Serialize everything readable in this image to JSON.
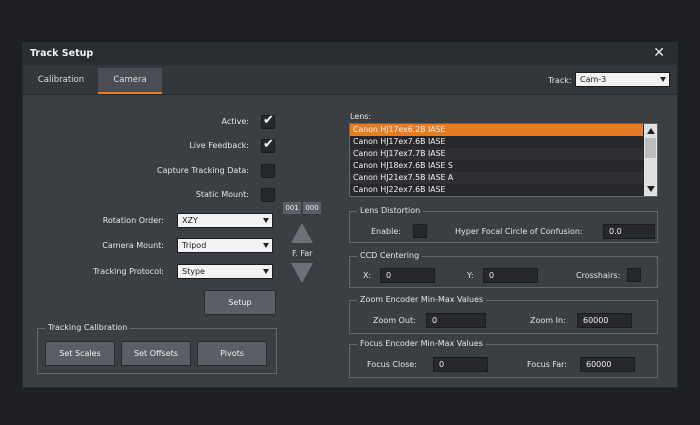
{
  "window": {
    "title": "Track Setup",
    "close_icon": "close-icon"
  },
  "tabs": [
    {
      "label": "Calibration"
    },
    {
      "label": "Camera"
    }
  ],
  "track": {
    "label": "Track:",
    "value": "Cam-3"
  },
  "camera": {
    "active_label": "Active:",
    "live_feedback_label": "Live Feedback:",
    "capture_tracking_label": "Capture Tracking Data:",
    "static_mount_label": "Static Mount:",
    "rotation_order_label": "Rotation Order:",
    "rotation_order_value": "XZY",
    "camera_mount_label": "Camera Mount:",
    "camera_mount_value": "Tripod",
    "tracking_protocol_label": "Tracking Protocol:",
    "tracking_protocol_value": "Stype",
    "setup_label": "Setup"
  },
  "checkboxes": {
    "active": true,
    "live_feedback": true,
    "capture_tracking": false,
    "static_mount": false
  },
  "tracking_calibration": {
    "title": "Tracking Calibration",
    "set_scales": "Set Scales",
    "set_offsets": "Set Offsets",
    "pivots": "Pivots"
  },
  "counter": {
    "left": "001",
    "right": "000"
  },
  "focus_ctrl": {
    "label": "F. Far"
  },
  "lens": {
    "label": "Lens:",
    "items": [
      "Canon HJ17ex6.2B IASE",
      "Canon HJ17ex7.6B IASE",
      "Canon HJ17ex7.7B IASE",
      "Canon HJ18ex7.6B IASE S",
      "Canon HJ21ex7.5B IASE A",
      "Canon HJ22ex7.6B IASE"
    ],
    "selected_index": 0
  },
  "lens_distortion": {
    "title": "Lens Distortion",
    "enable_label": "Enable:",
    "hyper_label": "Hyper Focal Circle of Confusion:",
    "hyper_value": "0.0"
  },
  "ccd": {
    "title": "CCD Centering",
    "x_label": "X:",
    "x_value": "0",
    "y_label": "Y:",
    "y_value": "0",
    "crosshairs_label": "Crosshairs:"
  },
  "zoom": {
    "title": "Zoom Encoder Min-Max Values",
    "out_label": "Zoom Out:",
    "out_value": "0",
    "in_label": "Zoom In:",
    "in_value": "60000"
  },
  "focus": {
    "title": "Focus Encoder Min-Max Values",
    "close_label": "Focus Close:",
    "close_value": "0",
    "far_label": "Focus Far:",
    "far_value": "60000"
  }
}
